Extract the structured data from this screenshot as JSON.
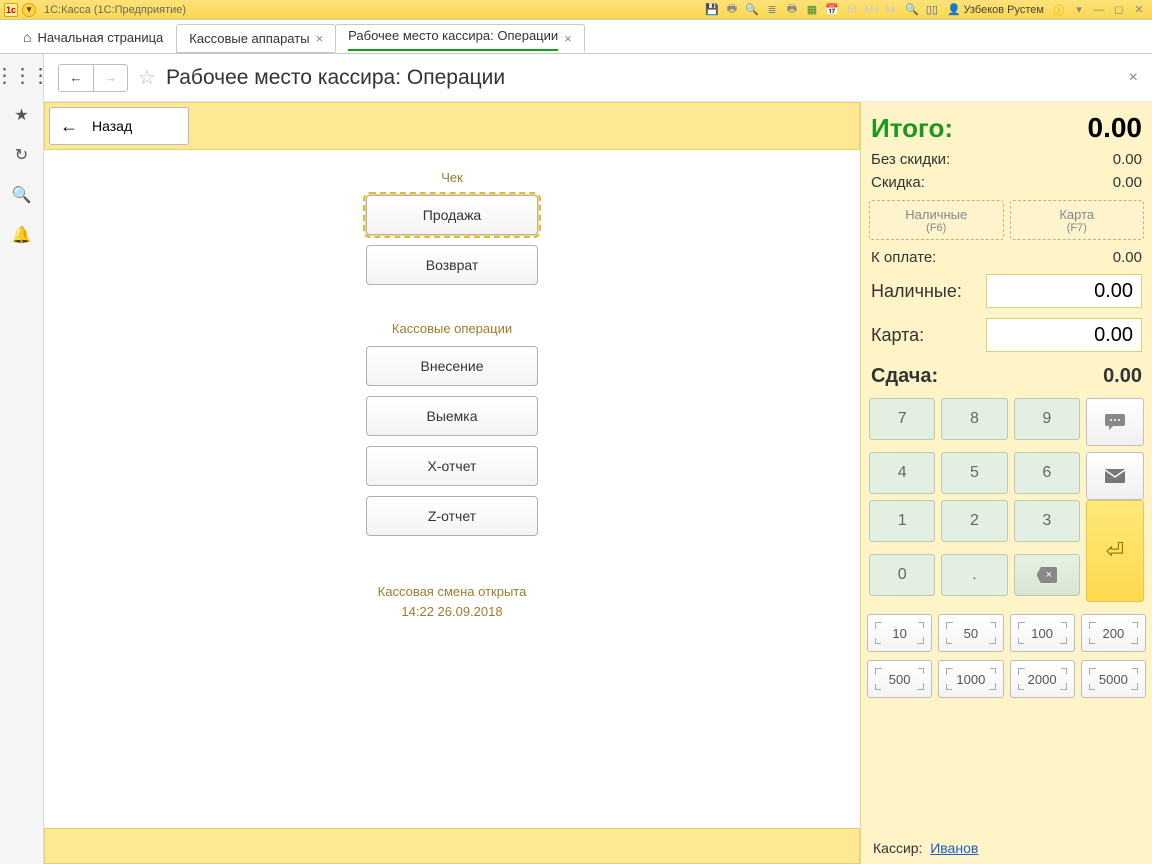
{
  "titlebar": {
    "app_title": "1С:Касса  (1С:Предприятие)",
    "user": "Узбеков Рустем"
  },
  "tabs": {
    "home": "Начальная страница",
    "open": [
      {
        "label": "Кассовые аппараты",
        "active": false
      },
      {
        "label": "Рабочее место кассира: Операции",
        "active": true
      }
    ]
  },
  "page": {
    "title": "Рабочее место кассира: Операции",
    "back": "Назад"
  },
  "groups": {
    "check": {
      "label": "Чек",
      "sale": "Продажа",
      "return": "Возврат"
    },
    "cashops": {
      "label": "Кассовые операции",
      "deposit": "Внесение",
      "withdraw": "Выемка",
      "xreport": "X-отчет",
      "zreport": "Z-отчет"
    }
  },
  "shift": {
    "line1": "Кассовая смена открыта",
    "line2": "14:22 26.09.2018"
  },
  "totals": {
    "total_label": "Итого:",
    "total": "0.00",
    "no_discount_label": "Без скидки:",
    "no_discount": "0.00",
    "discount_label": "Скидка:",
    "discount": "0.00",
    "cash_btn": "Наличные",
    "cash_btn_sub": "(F6)",
    "card_btn": "Карта",
    "card_btn_sub": "(F7)",
    "to_pay_label": "К оплате:",
    "to_pay": "0.00",
    "cash_label": "Наличные:",
    "cash_val": "0.00",
    "card_label": "Карта:",
    "card_val": "0.00",
    "change_label": "Сдача:",
    "change": "0.00"
  },
  "keypad": {
    "k7": "7",
    "k8": "8",
    "k9": "9",
    "k4": "4",
    "k5": "5",
    "k6": "6",
    "k1": "1",
    "k2": "2",
    "k3": "3",
    "k0": "0",
    "kdot": ".",
    "kbksp": "⌫",
    "kenter": "↵"
  },
  "denoms": {
    "r1": [
      "10",
      "50",
      "100",
      "200"
    ],
    "r2": [
      "500",
      "1000",
      "2000",
      "5000"
    ]
  },
  "cashier": {
    "label": "Кассир:",
    "name": "Иванов"
  }
}
